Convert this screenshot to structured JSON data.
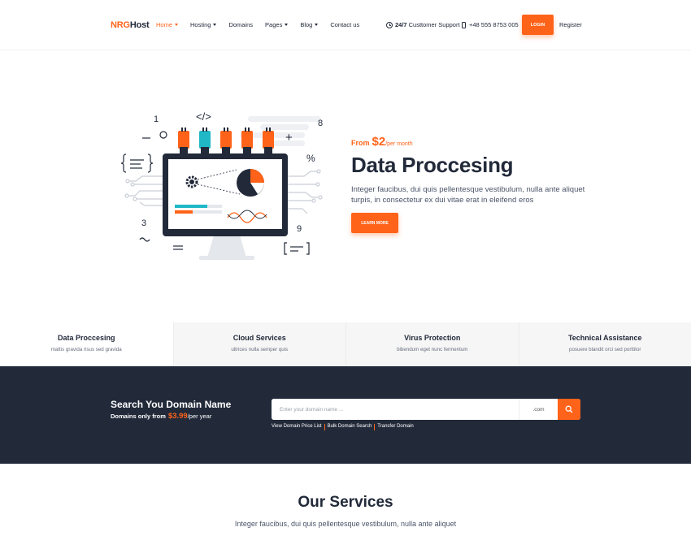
{
  "header": {
    "logo": {
      "part1": "NRG",
      "part2": "Host"
    },
    "nav": [
      {
        "label": "Home",
        "caret": true,
        "active": true
      },
      {
        "label": "Hosting",
        "caret": true
      },
      {
        "label": "Domains",
        "caret": false
      },
      {
        "label": "Pages",
        "caret": true
      },
      {
        "label": "Blog",
        "caret": true
      },
      {
        "label": "Contact us",
        "caret": false
      }
    ],
    "support_strong": "24/7",
    "support_text": "Custtomer Support",
    "phone": "+48 555 8753 005",
    "login_label": "LOGIN",
    "register_label": "Register"
  },
  "hero": {
    "from_label": "From",
    "price": "$2",
    "per": "/per month",
    "title": "Data Proccesing",
    "text": "Integer faucibus, dui quis pellentesque vestibulum, nulla ante aliquet turpis, in consectetur ex dui vitae erat in eleifend eros",
    "cta_label": "LEARN MORE",
    "illustration_symbols": [
      "1",
      "</>",
      "8",
      "%",
      "3",
      "9",
      "+"
    ]
  },
  "features": [
    {
      "title": "Data Proccesing",
      "subtitle": "mattis gravida risus sed gravida",
      "active": true
    },
    {
      "title": "Cloud Services",
      "subtitle": "ultrices nulla semper quis"
    },
    {
      "title": "Virus Protection",
      "subtitle": "bibendum eget nunc fermentum"
    },
    {
      "title": "Technical Assistance",
      "subtitle": "posuere blandit orci sed porttitor"
    }
  ],
  "domain": {
    "title": "Search You Domain Name",
    "subtitle_prefix": "Domains only from",
    "price": "$3.99",
    "per": "/per year",
    "placeholder": "Enter your domain name ...",
    "tld": ".com",
    "links": [
      "View Domain Price List",
      "Bulk Domain Search",
      "Transfer Domain"
    ]
  },
  "services": {
    "title": "Our Services",
    "text": "Integer faucibus, dui quis pellentesque vestibulum, nulla ante aliquet"
  },
  "colors": {
    "accent": "#ff6319",
    "dark": "#222a3a",
    "teal": "#20b8c6",
    "feature_bg": "#f6f6f6"
  }
}
